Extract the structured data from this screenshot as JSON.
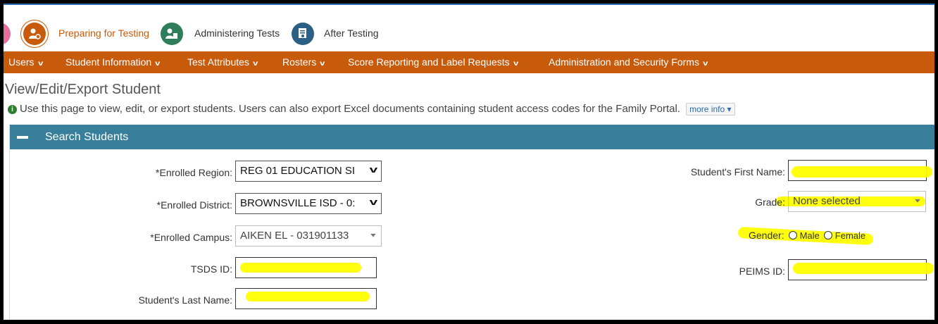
{
  "workflow": {
    "steps": [
      {
        "label": "Preparing for Testing",
        "color": "#c85a0c",
        "active": true
      },
      {
        "label": "Administering Tests",
        "color": "#2e7d5b",
        "active": false
      },
      {
        "label": "After Testing",
        "color": "#2b5f85",
        "active": false
      }
    ]
  },
  "nav": {
    "items": [
      {
        "label": "Users"
      },
      {
        "label": "Student Information"
      },
      {
        "label": "Test Attributes"
      },
      {
        "label": "Rosters"
      },
      {
        "label": "Score Reporting and Label Requests"
      },
      {
        "label": "Administration and Security Forms"
      }
    ]
  },
  "page": {
    "title": "View/Edit/Export Student",
    "info_text": "Use this page to view, edit, or export students. Users can also export Excel documents containing student access codes for the Family Portal.",
    "more_info": "more info",
    "info_icon": "i"
  },
  "search": {
    "header": "Search Students",
    "enrolled_region": {
      "label": "*Enrolled Region:",
      "value": "REG 01 EDUCATION SI"
    },
    "enrolled_district": {
      "label": "*Enrolled District:",
      "value": "BROWNSVILLE ISD - 0:"
    },
    "enrolled_campus": {
      "label": "*Enrolled Campus:",
      "value": "AIKEN EL - 031901133"
    },
    "tsds_id": {
      "label": "TSDS ID:",
      "value": ""
    },
    "last_name": {
      "label": "Student's Last Name:",
      "value": ""
    },
    "first_name": {
      "label": "Student's First Name:",
      "value": ""
    },
    "grade": {
      "label": "Grade:",
      "value": "None selected"
    },
    "gender": {
      "label": "Gender:",
      "options": [
        "Male",
        "Female"
      ]
    },
    "peims_id": {
      "label": "PEIMS ID:",
      "value": ""
    }
  },
  "colors": {
    "nav_bg": "#c85a0c",
    "panel_header": "#377f9b",
    "highlight": "#ffff00"
  }
}
